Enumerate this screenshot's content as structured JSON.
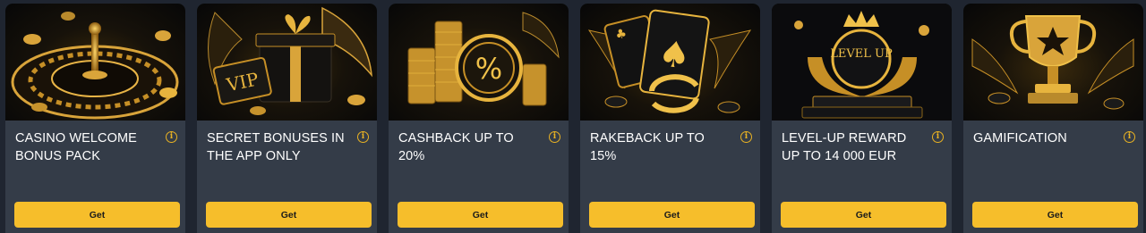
{
  "cards": [
    {
      "title": "CASINO WELCOME BONUS PACK",
      "info_icon": "info-icon",
      "button_label": "Get",
      "illustration": "roulette-wheel-icon"
    },
    {
      "title": "SECRET BONUSES IN THE APP ONLY",
      "info_icon": "info-icon",
      "button_label": "Get",
      "illustration": "vip-gift-box-icon"
    },
    {
      "title": "CASHBACK UP TO 20%",
      "info_icon": "info-icon",
      "button_label": "Get",
      "illustration": "percent-coin-stack-icon"
    },
    {
      "title": "RAKEBACK UP TO 15%",
      "info_icon": "info-icon",
      "button_label": "Get",
      "illustration": "playing-cards-icon"
    },
    {
      "title": "LEVEL-UP REWARD UP TO 14 000 EUR",
      "info_icon": "info-icon",
      "button_label": "Get",
      "illustration": "level-up-crown-icon",
      "badge_text": "LEVEL UP"
    },
    {
      "title": "GAMIFICATION",
      "info_icon": "info-icon",
      "button_label": "Get",
      "illustration": "trophy-cup-icon"
    }
  ],
  "colors": {
    "background": "#1f2530",
    "card": "#343c48",
    "accent": "#f6be2b",
    "gold": "#e9b223"
  },
  "vip_label": "VIP",
  "percent_label": "%"
}
